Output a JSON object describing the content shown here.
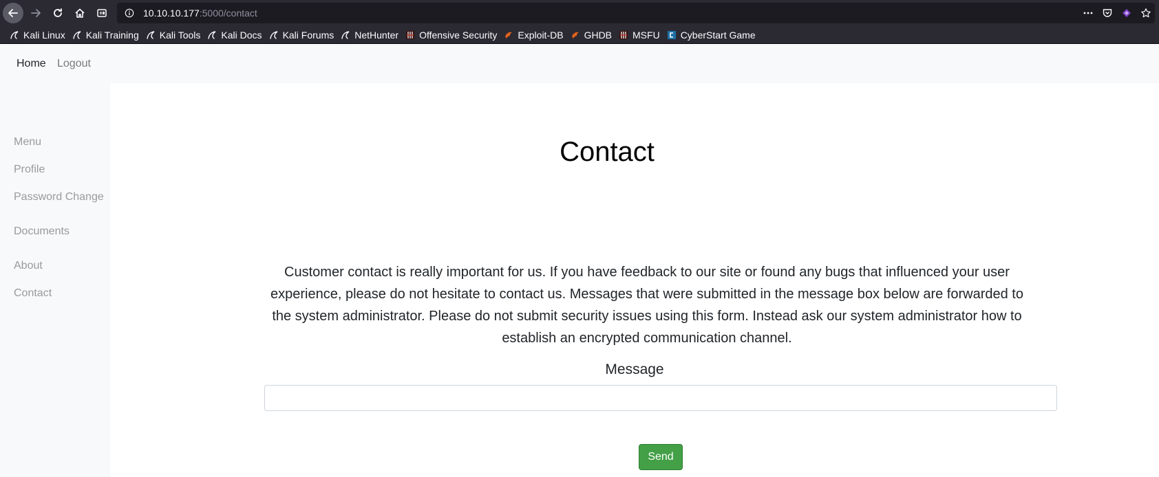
{
  "browser": {
    "url_host": "10.10.10.177",
    "url_path": ":5000/contact",
    "bookmarks": [
      {
        "label": "Kali Linux",
        "icon": "kali-dragon-icon"
      },
      {
        "label": "Kali Training",
        "icon": "kali-dragon-icon"
      },
      {
        "label": "Kali Tools",
        "icon": "kali-dragon-icon"
      },
      {
        "label": "Kali Docs",
        "icon": "kali-dragon-icon"
      },
      {
        "label": "Kali Forums",
        "icon": "kali-dragon-icon"
      },
      {
        "label": "NetHunter",
        "icon": "kali-dragon-icon"
      },
      {
        "label": "Offensive Security",
        "icon": "offsec-icon"
      },
      {
        "label": "Exploit-DB",
        "icon": "exploitdb-icon"
      },
      {
        "label": "GHDB",
        "icon": "exploitdb-icon"
      },
      {
        "label": "MSFU",
        "icon": "offsec-icon"
      },
      {
        "label": "CyberStart Game",
        "icon": "cyberstart-icon"
      }
    ]
  },
  "topnav": {
    "home": "Home",
    "logout": "Logout"
  },
  "sidebar": {
    "items": [
      "Menu",
      "Profile",
      "Password Change",
      "Documents",
      "About",
      "Contact"
    ]
  },
  "main": {
    "title": "Contact",
    "description": "Customer contact is really important for us. If you have feedback to our site or found any bugs that influenced your user experience, please do not hesitate to contact us. Messages that were submitted in the message box below are forwarded to the system administrator. Please do not submit security issues using this form. Instead ask our system administrator how to establish an encrypted communication channel.",
    "message_label": "Message",
    "message_value": "",
    "send_label": "Send"
  },
  "colors": {
    "send_button": "#43a047",
    "chrome_bg": "#2b2a33"
  }
}
